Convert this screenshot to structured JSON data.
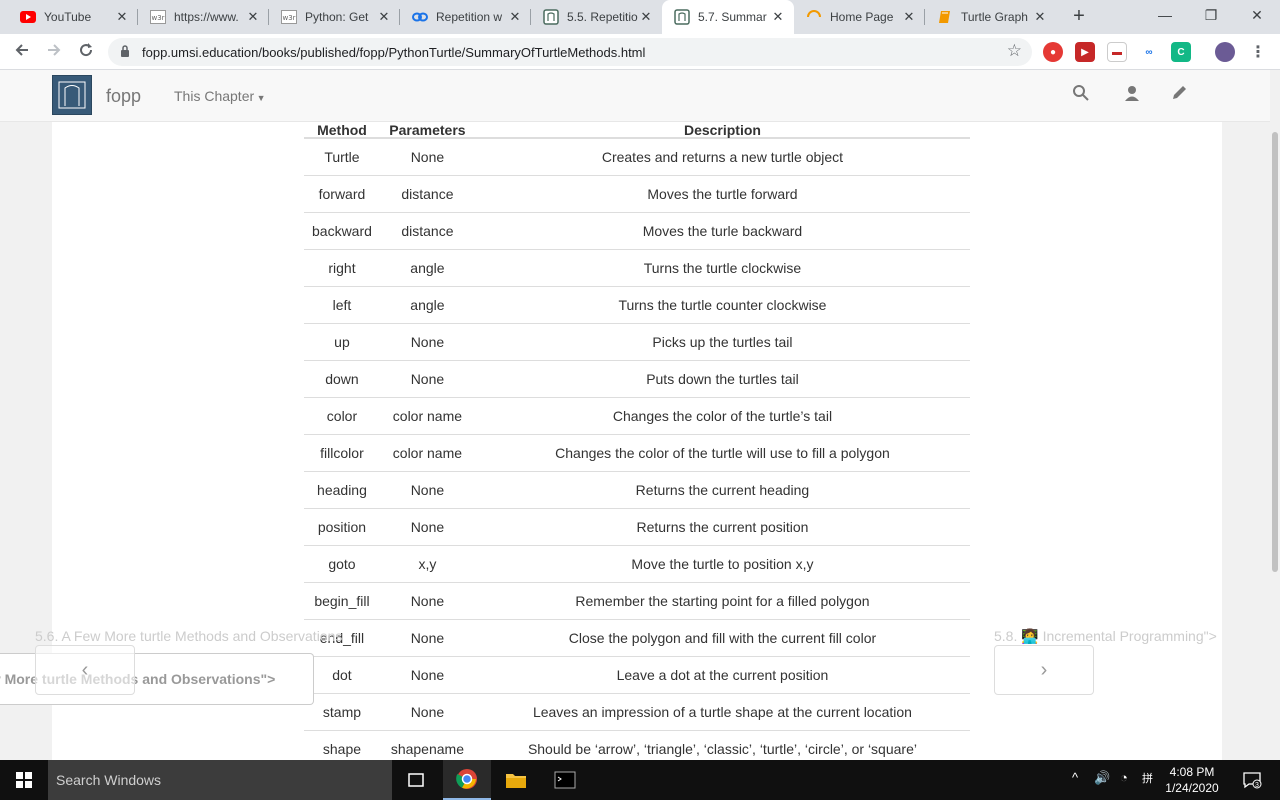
{
  "tabs": [
    {
      "title": "YouTube",
      "icon": "youtube-icon",
      "active": false
    },
    {
      "title": "https://www.",
      "icon": "w3schools-icon",
      "active": false
    },
    {
      "title": "Python: Get",
      "icon": "w3schools-icon",
      "active": false
    },
    {
      "title": "Repetition w",
      "icon": "codepen-loop-icon",
      "active": false
    },
    {
      "title": "5.5. Repetitio",
      "icon": "runestone-icon",
      "active": false
    },
    {
      "title": "5.7. Summar",
      "icon": "runestone-icon",
      "active": true
    },
    {
      "title": "Home Page",
      "icon": "loading-spinner-icon",
      "active": false
    },
    {
      "title": "Turtle Graph",
      "icon": "book-icon",
      "active": false
    }
  ],
  "window_controls": {
    "minimize": "—",
    "restore": "❐",
    "close": "✕"
  },
  "address_bar": {
    "url": "fopp.umsi.education/books/published/fopp/PythonTurtle/SummaryOfTurtleMethods.html"
  },
  "site_nav": {
    "brand": "fopp",
    "chapter_menu": "This Chapter"
  },
  "table": {
    "headers": [
      "Method",
      "Parameters",
      "Description"
    ],
    "rows": [
      [
        "Turtle",
        "None",
        "Creates and returns a new turtle object"
      ],
      [
        "forward",
        "distance",
        "Moves the turtle forward"
      ],
      [
        "backward",
        "distance",
        "Moves the turle backward"
      ],
      [
        "right",
        "angle",
        "Turns the turtle clockwise"
      ],
      [
        "left",
        "angle",
        "Turns the turtle counter clockwise"
      ],
      [
        "up",
        "None",
        "Picks up the turtles tail"
      ],
      [
        "down",
        "None",
        "Puts down the turtles tail"
      ],
      [
        "color",
        "color name",
        "Changes the color of the turtle’s tail"
      ],
      [
        "fillcolor",
        "color name",
        "Changes the color of the turtle will use to fill a polygon"
      ],
      [
        "heading",
        "None",
        "Returns the current heading"
      ],
      [
        "position",
        "None",
        "Returns the current position"
      ],
      [
        "goto",
        "x,y",
        "Move the turtle to position x,y"
      ],
      [
        "begin_fill",
        "None",
        "Remember the starting point for a filled polygon"
      ],
      [
        "end_fill",
        "None",
        "Close the polygon and fill with the current fill color"
      ],
      [
        "dot",
        "None",
        "Leave a dot at the current position"
      ],
      [
        "stamp",
        "None",
        "Leaves an impression of a turtle shape at the current location"
      ],
      [
        "shape",
        "shapename",
        "Should be ‘arrow’, ‘triangle’, ‘classic’, ‘turtle’, ‘circle’, or ‘square’"
      ]
    ]
  },
  "pager": {
    "prev_text": "5.6. A Few More turtle Methods and Observations",
    "next_text": "5.8. 👩‍💻 Incremental Programming\">",
    "prev_tooltip": "ew More turtle Methods and Observations\">",
    "prev_arrow": "‹",
    "next_arrow": "›"
  },
  "taskbar": {
    "search_placeholder": "Search Windows",
    "time": "4:08 PM",
    "date": "1/24/2020",
    "notification_count": "3"
  },
  "colors": {
    "tab_strip": "#dee1e6",
    "nav_bar": "#f8f8f8",
    "logo": "#385a78",
    "taskbar": "#101010"
  }
}
